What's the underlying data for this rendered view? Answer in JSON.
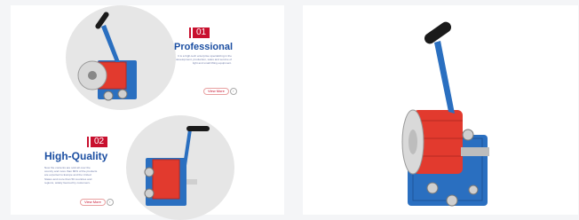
{
  "left_card": {
    "section1": {
      "number": "01",
      "title": "Professional",
      "description": "It is a high-tech enterprise specializing in the development, production, sales and service of light and small lifting equipment.",
      "more_label": "View More",
      "more_arrow": "›"
    },
    "section2": {
      "number": "02",
      "title": "High-Quality",
      "description": "Now the contents are sold all over the country and more than 80% of the products are exported to Europe and the United States and more than 50 countries and regions, widely favored by customers.",
      "more_label": "View More",
      "more_arrow": "›"
    }
  },
  "icons": {
    "product_image": "hand-winch-image"
  },
  "colors": {
    "accent_red": "#c8102e",
    "winch_blue": "#2a6fc0",
    "strap_red": "#e23a2e",
    "heading_blue": "#1c4fa2"
  }
}
